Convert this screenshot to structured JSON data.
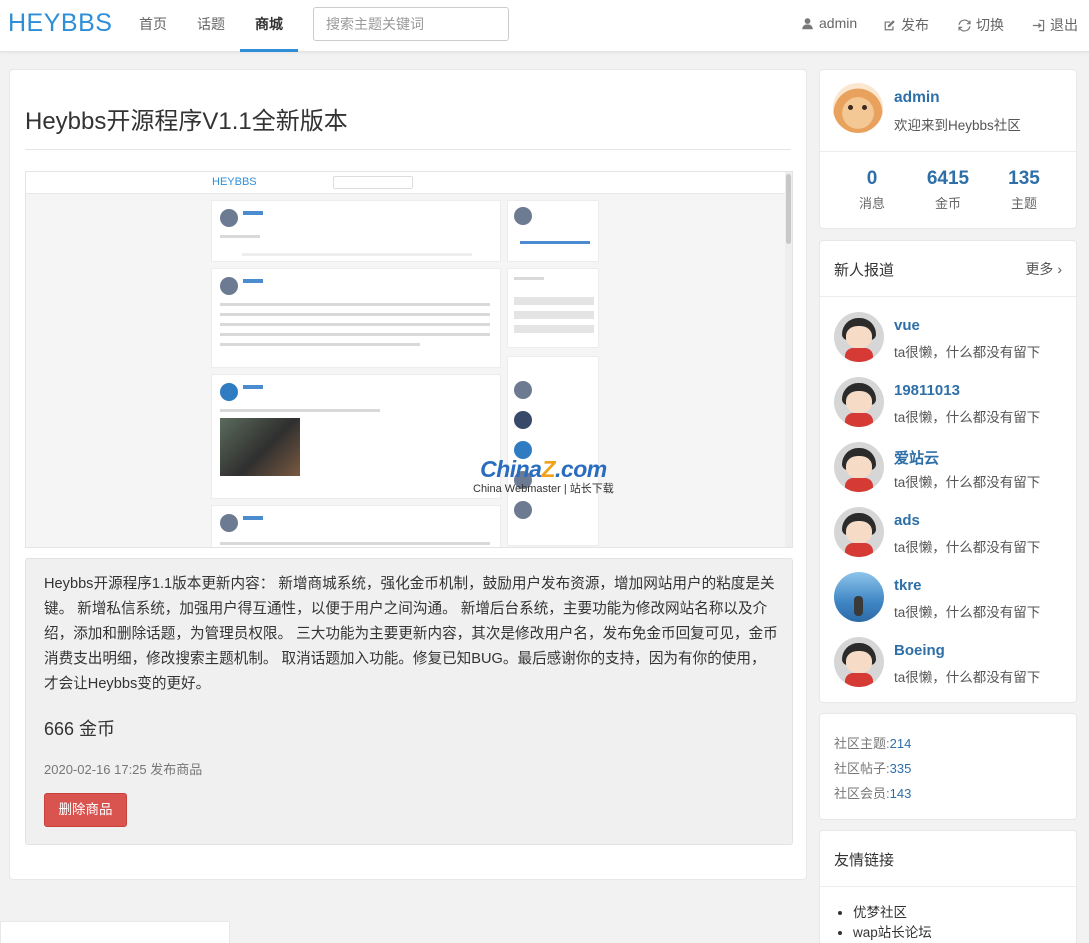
{
  "nav": {
    "brand": "HEYBBS",
    "items": [
      {
        "label": "首页"
      },
      {
        "label": "话题"
      },
      {
        "label": "商城"
      }
    ],
    "search_placeholder": "搜索主题关键词",
    "right": [
      {
        "icon": "user-icon",
        "label": "admin"
      },
      {
        "icon": "edit-icon",
        "label": "发布"
      },
      {
        "icon": "refresh-icon",
        "label": "切换"
      },
      {
        "icon": "logout-icon",
        "label": "退出"
      }
    ]
  },
  "product": {
    "title": "Heybbs开源程序V1.1全新版本",
    "screenshot": {
      "brand": "HEYBBS",
      "watermark_main": "China",
      "watermark_z": "Z",
      "watermark_tail": ".com",
      "watermark_sub": "China Webmaster | 站长下载"
    },
    "description": "Heybbs开源程序1.1版本更新内容： 新增商城系统，强化金币机制，鼓励用户发布资源，增加网站用户的粘度是关键。 新增私信系统，加强用户得互通性，以便于用户之间沟通。 新增后台系统，主要功能为修改网站名称以及介绍，添加和删除话题，为管理员权限。 三大功能为主要更新内容，其次是修改用户名，发布免金币回复可见，金币消费支出明细，修改搜索主题机制。 取消话题加入功能。修复已知BUG。最后感谢你的支持，因为有你的使用，才会让Heybbs变的更好。",
    "price": "666 金币",
    "date": "2020-02-16 17:25 发布商品",
    "delete_label": "删除商品"
  },
  "profile": {
    "name": "admin",
    "welcome": "欢迎来到Heybbs社区",
    "stats": [
      {
        "value": "0",
        "label": "消息"
      },
      {
        "value": "6415",
        "label": "金币"
      },
      {
        "value": "135",
        "label": "主题"
      }
    ]
  },
  "newbies": {
    "title": "新人报道",
    "more": "更多",
    "users": [
      {
        "name": "vue",
        "desc": "ta很懒，什么都没有留下"
      },
      {
        "name": "19811013",
        "desc": "ta很懒，什么都没有留下"
      },
      {
        "name": "爱站云",
        "desc": "ta很懒，什么都没有留下"
      },
      {
        "name": "ads",
        "desc": "ta很懒，什么都没有留下"
      },
      {
        "name": "tkre",
        "desc": "ta很懒，什么都没有留下"
      },
      {
        "name": "Boeing",
        "desc": "ta很懒，什么都没有留下"
      }
    ]
  },
  "community": {
    "topics_label": "社区主题:",
    "topics": "214",
    "posts_label": "社区帖子:",
    "posts": "335",
    "members_label": "社区会员:",
    "members": "143"
  },
  "links": {
    "title": "友情链接",
    "items": [
      "优梦社区",
      "wap站长论坛"
    ]
  }
}
